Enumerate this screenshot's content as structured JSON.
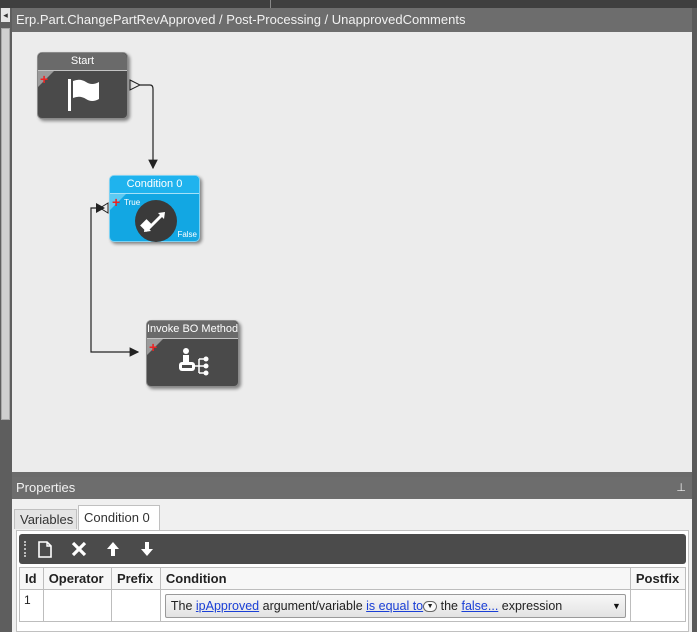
{
  "canvas": {
    "title": "Erp.Part.ChangePartRevApproved / Post-Processing / UnapprovedComments"
  },
  "nodes": {
    "start": {
      "title": "Start",
      "icon": "flag-icon"
    },
    "condition": {
      "title": "Condition 0",
      "true_label": "True",
      "false_label": "False",
      "icon": "condition-arrows-icon"
    },
    "invoke": {
      "title": "Invoke BO Method",
      "icon": "bo-method-icon"
    }
  },
  "properties": {
    "title": "Properties",
    "pin_glyph": "⊥",
    "tabs": [
      {
        "label": "Variables"
      },
      {
        "label": "Condition 0"
      }
    ],
    "toolbar": {
      "new": "new-document-icon",
      "delete": "delete-icon",
      "up": "move-up-icon",
      "down": "move-down-icon"
    },
    "columns": [
      "Id",
      "Operator",
      "Prefix",
      "Condition",
      "Postfix"
    ],
    "rows": [
      {
        "id": "1",
        "operator": "",
        "prefix": "",
        "condition": {
          "t1": "The ",
          "link1": "ipApproved",
          "t2": " argument/variable ",
          "link2": "is equal to",
          "t3": " the ",
          "link3": "false...",
          "t4": " expression"
        },
        "postfix": ""
      }
    ]
  },
  "colors": {
    "condition_node": "#12a7e3",
    "dark_node": "#4a4a4a",
    "link": "#1a3fd6"
  }
}
